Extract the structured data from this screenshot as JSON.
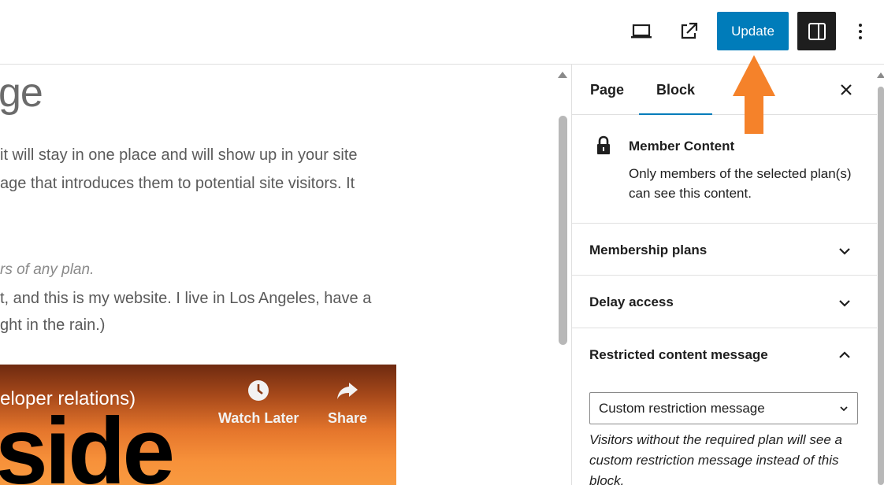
{
  "toolbar": {
    "update_label": "Update",
    "icons": [
      "desktop-preview-icon",
      "external-link-icon",
      "settings-panel-icon",
      "more-options-icon"
    ]
  },
  "canvas": {
    "heading_fragment": "ge",
    "paragraph_lines": [
      "it will stay in one place and will show up in your site",
      "age that introduces them to potential site visitors. It"
    ],
    "italic_line": "rs of any plan.",
    "paragraph2_lines": [
      "t, and this is my website. I live in Los Angeles, have a",
      "ght in the rain.)"
    ],
    "video": {
      "title_fragment": "eloper relations)",
      "big_text": "side",
      "watch_later_label": "Watch Later",
      "share_label": "Share"
    }
  },
  "sidebar": {
    "tabs": [
      {
        "label": "Page",
        "active": false
      },
      {
        "label": "Block",
        "active": true
      }
    ],
    "block": {
      "title": "Member Content",
      "description": "Only members of the selected plan(s) can see this content."
    },
    "panels": [
      {
        "title": "Membership plans",
        "expanded": false
      },
      {
        "title": "Delay access",
        "expanded": false
      },
      {
        "title": "Restricted content message",
        "expanded": true
      }
    ],
    "restriction_select": {
      "value": "Custom restriction message"
    },
    "help_text": "Visitors without the required plan will see a custom restriction message instead of this block."
  },
  "colors": {
    "accent": "#007cba",
    "annotation": "#f5822a",
    "dark_button": "#1e1e1e"
  }
}
